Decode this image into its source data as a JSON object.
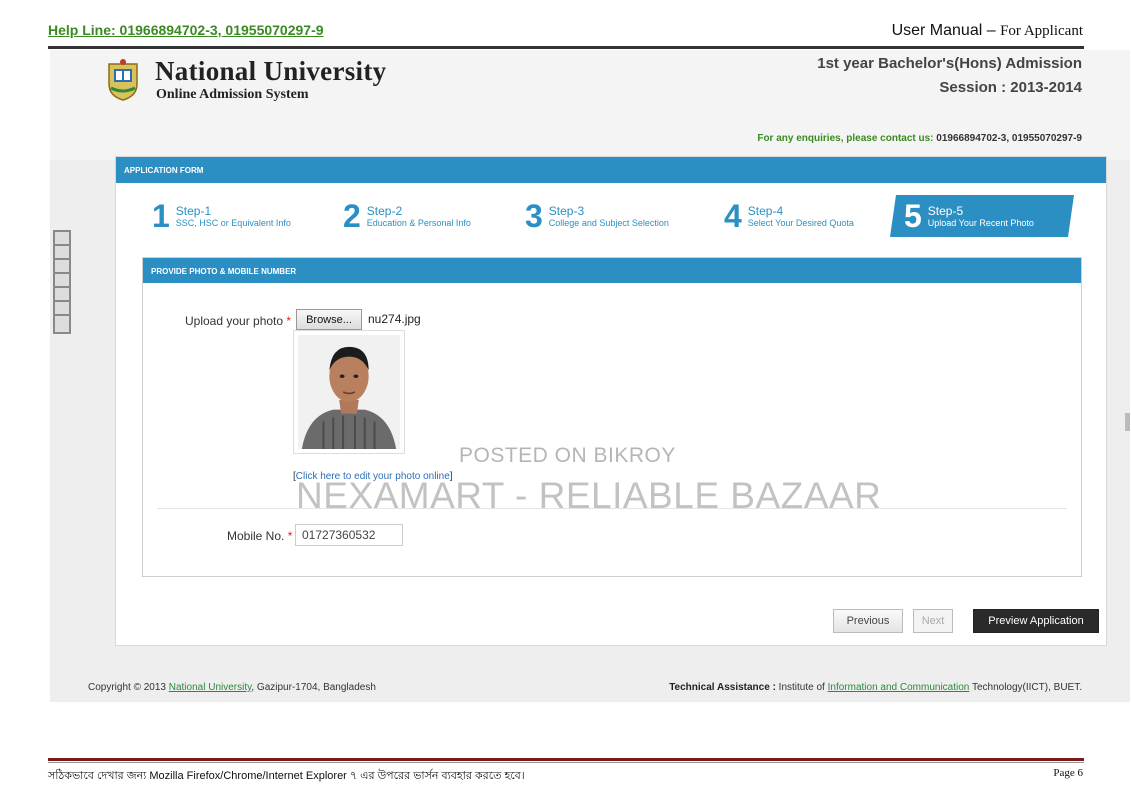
{
  "doc": {
    "helpline": "Help Line: 01966894702-3, 01955070297-9",
    "title_prefix": "User",
    "title_mid": " Manual – ",
    "title_suffix": "For Applicant",
    "footer_text": "সঠিকভাবে দেখার জন্য  Mozilla Firefox/Chrome/Internet Explorer ৭ এর উপরের ভার্সন ব্যবহার করতে হবে।",
    "page": "Page 6"
  },
  "site": {
    "name": "National University",
    "subtitle": "Online Admission System",
    "admission_title": "1st year Bachelor's(Hons) Admission",
    "session": "Session : 2013-2014",
    "enquiry_label": "For any enquiries, please contact us:",
    "enquiry_numbers": "01966894702-3, 01955070297-9"
  },
  "form": {
    "bar_title": "APPLICATION FORM",
    "steps": [
      {
        "num": "1",
        "title": "Step-1",
        "desc": "SSC, HSC or Equivalent Info"
      },
      {
        "num": "2",
        "title": "Step-2",
        "desc": "Education & Personal Info"
      },
      {
        "num": "3",
        "title": "Step-3",
        "desc": "College and Subject Selection"
      },
      {
        "num": "4",
        "title": "Step-4",
        "desc": "Select Your Desired Quota"
      },
      {
        "num": "5",
        "title": "Step-5",
        "desc": "Upload Your Recent Photo"
      }
    ],
    "active_step": 5,
    "panel_title": "PROVIDE PHOTO & MOBILE NUMBER",
    "upload_label": "Upload your photo",
    "required_mark": "*",
    "browse_label": "Browse...",
    "file_name": "nu274.jpg",
    "edit_link_open": "[",
    "edit_link": "Click here to edit your photo online",
    "edit_link_close": "]",
    "mobile_label": "Mobile No.",
    "mobile_value": "01727360532",
    "buttons": {
      "previous": "Previous",
      "next": "Next",
      "preview": "Preview Application"
    }
  },
  "footer": {
    "copyright_prefix": "Copyright © 2013 ",
    "copyright_link": "National University",
    "copyright_suffix": ", Gazipur-1704, Bangladesh",
    "tech_label": "Technical Assistance :",
    "tech_prefix": " Institute of ",
    "tech_link": "Information and Communication",
    "tech_suffix": " Technology(IICT), BUET."
  },
  "watermark": {
    "line1": "POSTED ON BIKROY",
    "line2": "NEXAMART - RELIABLE BAZAAR"
  },
  "colors": {
    "accent": "#2b8fc4",
    "link_green": "#3a8a22",
    "dark_button": "#2a2a2a"
  }
}
